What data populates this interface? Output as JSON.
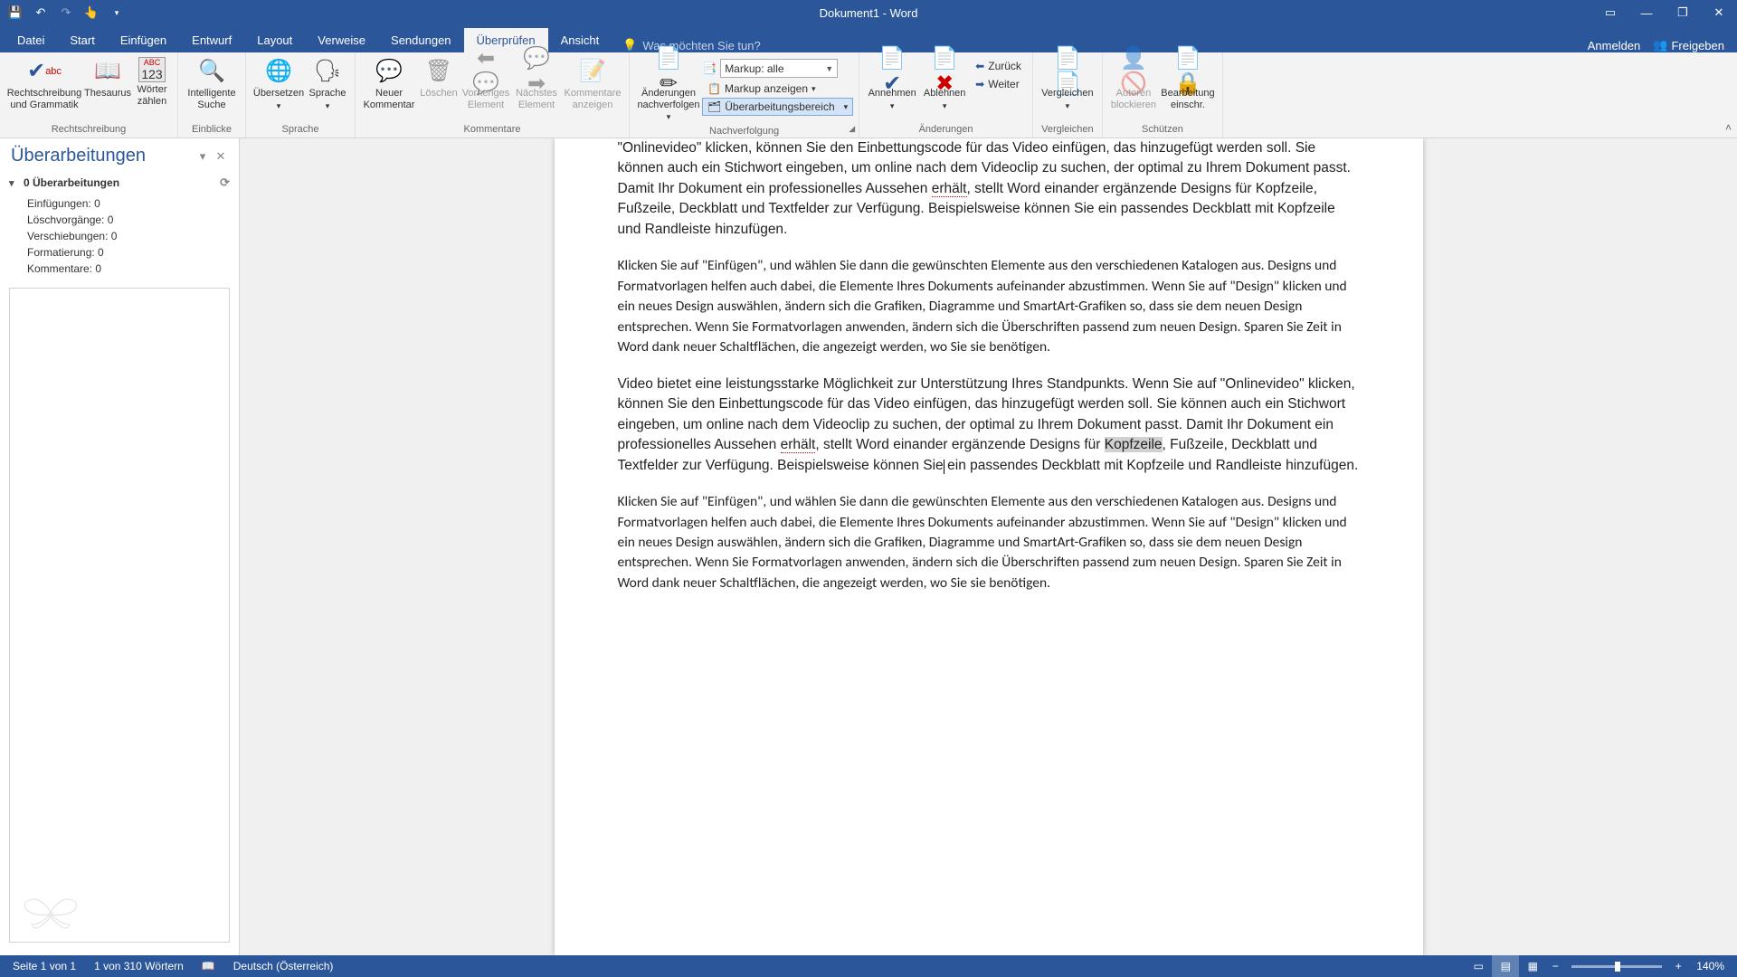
{
  "title": "Dokument1 - Word",
  "qat_tooltip": {
    "save": "Speichern",
    "undo": "Rückgängig",
    "redo": "Wiederholen",
    "touch": "Touch/Maus"
  },
  "tabs": {
    "file": "Datei",
    "start": "Start",
    "insert": "Einfügen",
    "design": "Entwurf",
    "layout": "Layout",
    "references": "Verweise",
    "mailings": "Sendungen",
    "review": "Überprüfen",
    "view": "Ansicht"
  },
  "tell_me": "Was möchten Sie tun?",
  "account": {
    "signin": "Anmelden",
    "share": "Freigeben"
  },
  "ribbon": {
    "proofing": {
      "spell": "Rechtschreibung und Grammatik",
      "thesaurus": "Thesaurus",
      "wordcount": "Wörter zählen",
      "group": "Rechtschreibung"
    },
    "insights": {
      "smart": "Intelligente Suche",
      "group": "Einblicke"
    },
    "language": {
      "translate": "Übersetzen",
      "lang": "Sprache",
      "group": "Sprache"
    },
    "comments": {
      "new": "Neuer Kommentar",
      "delete": "Löschen",
      "prev": "Vorheriges Element",
      "next": "Nächstes Element",
      "show": "Kommentare anzeigen",
      "group": "Kommentare"
    },
    "tracking": {
      "track": "Änderungen nachverfolgen",
      "markup_label": "Markup: alle",
      "show_markup": "Markup anzeigen",
      "pane": "Überarbeitungsbereich",
      "group": "Nachverfolgung"
    },
    "changes": {
      "accept": "Annehmen",
      "reject": "Ablehnen",
      "back": "Zurück",
      "next": "Weiter",
      "group": "Änderungen"
    },
    "compare": {
      "compare": "Vergleichen",
      "group": "Vergleichen"
    },
    "protect": {
      "block": "Autoren blockieren",
      "restrict": "Bearbeitung einschr.",
      "group": "Schützen"
    }
  },
  "revpane": {
    "title": "Überarbeitungen",
    "summary": "0 Überarbeitungen",
    "items": {
      "insert": "Einfügungen: 0",
      "delete": "Löschvorgänge: 0",
      "move": "Verschiebungen: 0",
      "format": "Formatierung: 0",
      "comment": "Kommentare: 0"
    }
  },
  "doc": {
    "p1a": "\"Onlinevideo\" klicken, können Sie den Einbettungscode für das Video einfügen, das hinzugefügt werden soll. Sie können auch ein Stichwort eingeben, um online nach dem Videoclip zu suchen, der optimal zu Ihrem Dokument passt. Damit Ihr Dokument ein professionelles Aussehen ",
    "p1err": "erhält",
    "p1b": ", stellt Word einander ergänzende Designs für Kopfzeile, Fußzeile, Deckblatt und Textfelder zur Verfügung. Beispielsweise können Sie ein passendes Deckblatt mit Kopfzeile und Randleiste hinzufügen.",
    "p2": "Klicken Sie auf \"Einfügen\", und wählen Sie dann die gewünschten Elemente aus den verschiedenen Katalogen aus. Designs und Formatvorlagen helfen auch dabei, die Elemente Ihres Dokuments aufeinander abzustimmen. Wenn Sie auf \"Design\" klicken und ein neues Design auswählen, ändern sich die Grafiken, Diagramme und SmartArt-Grafiken so, dass sie dem neuen Design entsprechen. Wenn Sie Formatvorlagen anwenden, ändern sich die Überschriften passend zum neuen Design. Sparen Sie Zeit in Word dank neuer Schaltflächen, die angezeigt werden, wo Sie sie benötigen.",
    "p3a": "Video bietet eine leistungsstarke Möglichkeit zur Unterstützung Ihres Standpunkts. Wenn Sie auf \"Onlinevideo\" klicken, können Sie den Einbettungscode für das Video einfügen, das hinzugefügt werden soll. Sie können auch ein Stichwort eingeben, um online nach dem Videoclip zu suchen, der optimal zu Ihrem Dokument passt. Damit Ihr Dokument ein professionelles Aussehen ",
    "p3err": "erhält",
    "p3b": ", stellt Word einander ergänzende Designs für ",
    "p3hl": "Kopfzeile",
    "p3c": ", Fußzeile, Deckblatt und Textfelder zur Verfügung. Beispielsweise können Sie",
    "p3d": "ein passendes Deckblatt mit Kopfzeile und Randleiste hinzufügen.",
    "p4": "Klicken Sie auf \"Einfügen\", und wählen Sie dann die gewünschten Elemente aus den verschiedenen Katalogen aus. Designs und Formatvorlagen helfen auch dabei, die Elemente Ihres Dokuments aufeinander abzustimmen. Wenn Sie auf \"Design\" klicken und ein neues Design auswählen, ändern sich die Grafiken, Diagramme und SmartArt-Grafiken so, dass sie dem neuen Design entsprechen. Wenn Sie Formatvorlagen anwenden, ändern sich die Überschriften passend zum neuen Design. Sparen Sie Zeit in Word dank neuer Schaltflächen, die angezeigt werden, wo Sie sie benötigen."
  },
  "status": {
    "page": "Seite 1 von 1",
    "words": "1 von 310 Wörtern",
    "lang": "Deutsch (Österreich)",
    "zoom": "140%"
  }
}
